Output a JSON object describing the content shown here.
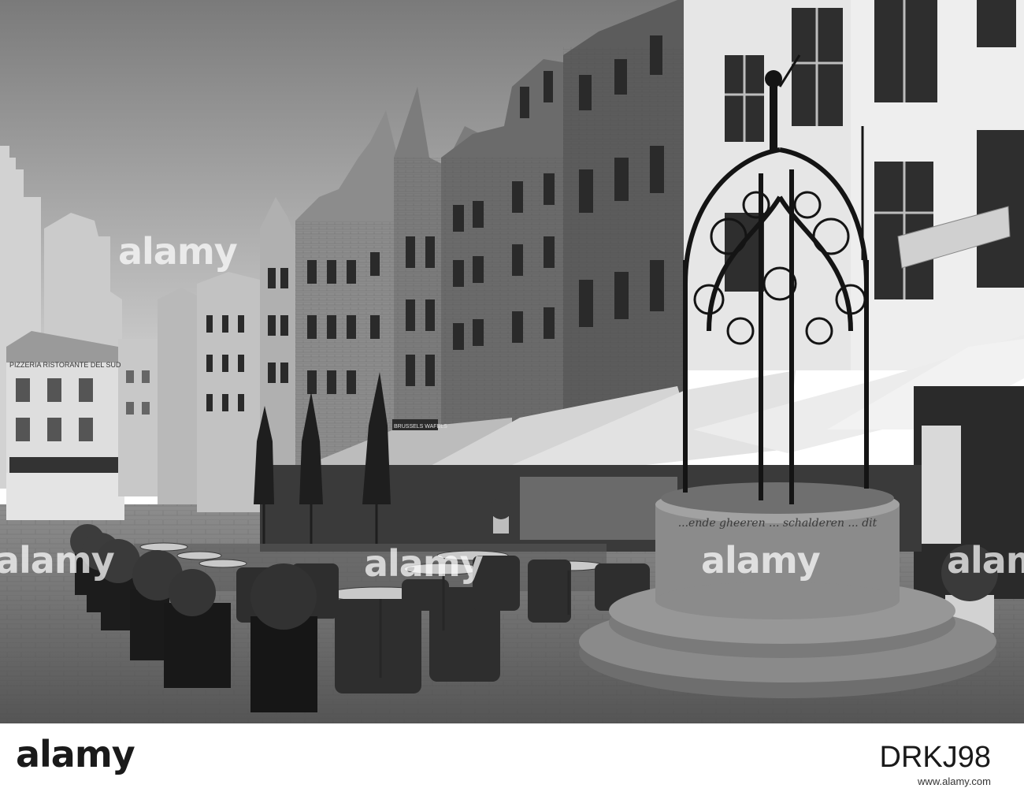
{
  "watermark": {
    "text": "alamy"
  },
  "footer": {
    "logo": "alamy",
    "image_id": "DRKJ98",
    "url": "www.alamy.com"
  },
  "well": {
    "inscription": "...ende gheeren ... schalderen ... dit"
  },
  "signs": {
    "left_building": "PIZZERIA RISTORANTE DEL SUD",
    "shop_wafels": "BRUSSELS WAFELS"
  }
}
